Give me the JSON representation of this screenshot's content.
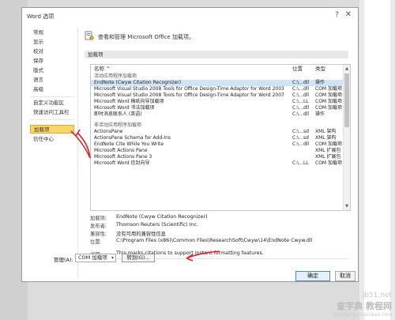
{
  "window": {
    "title": "Word 选项"
  },
  "nav": {
    "items": [
      "常规",
      "显示",
      "校对",
      "保存",
      "版式",
      "语言",
      "高级",
      "自定义功能区",
      "快速访问工具栏",
      "加载项",
      "信任中心"
    ],
    "selected": "加载项"
  },
  "header": {
    "text": "查看和管理 Microsoft Office 加载项。"
  },
  "section": {
    "title": "加载项"
  },
  "table": {
    "headers": {
      "name": "名称 ^",
      "location": "位置",
      "type": "类型"
    },
    "rows": [
      {
        "name": "活动应用程序加载项",
        "location": "",
        "type": "",
        "group": true
      },
      {
        "name": "EndNote (Cwyw Citation Recognizer)",
        "location": "C:\\...dll",
        "type": "操作",
        "selected": true
      },
      {
        "name": "Microsoft Visual Studio 2008 Tools for Office Design-Time Adaptor for Word 2003",
        "location": "C:\\...dll",
        "type": "COM 加载项"
      },
      {
        "name": "Microsoft Visual Studio 2008 Tools for Office Design-Time Adaptor for Word 2007",
        "location": "C:\\...dll",
        "type": "COM 加载项"
      },
      {
        "name": "Microsoft Word 稿纸向导加载项",
        "location": "C:\\...LL",
        "type": "COM 加载项"
      },
      {
        "name": "Microsoft Word 书法加载项",
        "location": "C:\\...dll",
        "type": "COM 加载项"
      },
      {
        "name": "即时消息联系人 (英语)",
        "location": "C:\\...dll",
        "type": "操作"
      },
      {
        "name": "",
        "location": "",
        "type": "",
        "spacer": true
      },
      {
        "name": "非活动应用程序加载项",
        "location": "",
        "type": "",
        "group": true
      },
      {
        "name": "ActionsPane",
        "location": "C:\\...sd",
        "type": "XML 架构"
      },
      {
        "name": "ActionsPane Schema for Add-Ins",
        "location": "C:\\...sd",
        "type": "XML 架构"
      },
      {
        "name": "EndNote Cite While You Write",
        "location": "C:\\...dll",
        "type": "COM 加载项"
      },
      {
        "name": "Microsoft Actions Pane",
        "location": "",
        "type": "XML 扩展包"
      },
      {
        "name": "Microsoft Actions Pane 3",
        "location": "",
        "type": "XML 扩展包"
      },
      {
        "name": "Microsoft Word 信封向导",
        "location": "C:\\...LL",
        "type": "COM 加载项"
      }
    ]
  },
  "details": {
    "addin": {
      "label": "加载项:",
      "value": "EndNote (Cwyw Citation Recognizer)"
    },
    "publisher": {
      "label": "发布者:",
      "value": "Thomson Reuters (Scientific) Inc."
    },
    "compat": {
      "label": "兼容性:",
      "value": "没有可用的兼容性信息"
    },
    "location": {
      "label": "位置:",
      "value": "C:\\Program Files (x86)\\Common Files\\ResearchSoft\\Cwyw\\14\\EndNote Cwyw.dll"
    },
    "desc": {
      "label": "说明:",
      "value": "This marks citations to support instant formatting features."
    }
  },
  "manage": {
    "label": "管理(A):",
    "selected": "COM 加载项",
    "go_label": "转到(G)..."
  },
  "buttons": {
    "ok": "确定",
    "cancel": "取消"
  },
  "watermark": {
    "line1": "jb51.net",
    "line2": "查字典 教程网",
    "line3": "jiaocheng.chazidian.com"
  },
  "colors": {
    "accent": "#4a86c8",
    "selected_nav": "#fbd56a",
    "selected_row": "#cfe4f7",
    "annotation": "#e0242b"
  }
}
